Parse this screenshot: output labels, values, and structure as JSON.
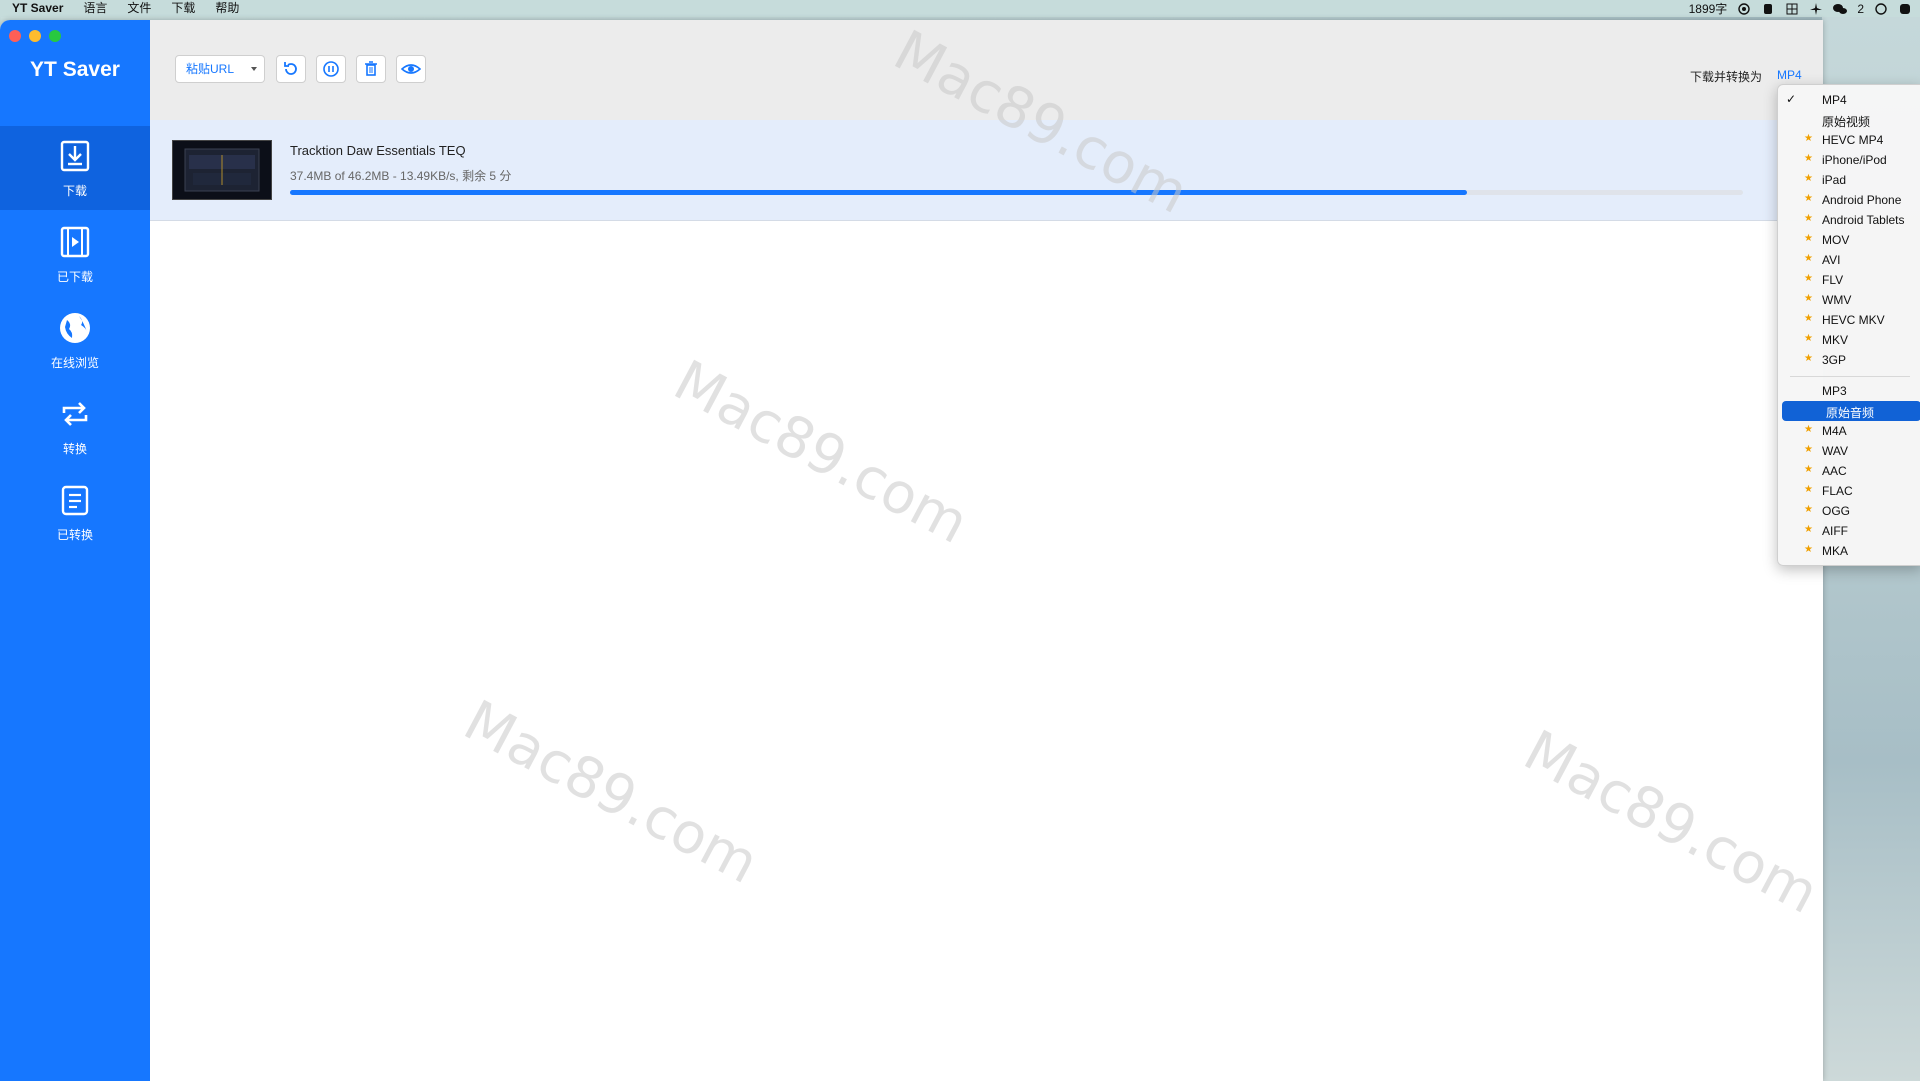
{
  "menubar": {
    "items": [
      "YT Saver",
      "语言",
      "文件",
      "下载",
      "帮助"
    ],
    "word_count": "1899字",
    "wechat_badge": "2"
  },
  "app": {
    "title": "YT Saver"
  },
  "sidebar": {
    "items": [
      {
        "label": "下载",
        "icon": "download-icon"
      },
      {
        "label": "已下载",
        "icon": "film-icon"
      },
      {
        "label": "在线浏览",
        "icon": "globe-icon"
      },
      {
        "label": "转换",
        "icon": "convert-icon"
      },
      {
        "label": "已转换",
        "icon": "document-list-icon"
      }
    ]
  },
  "toolbar": {
    "paste_url_label": "粘贴URL",
    "format_label": "下载并转换为",
    "format_value": "MP4"
  },
  "download": {
    "title": "Tracktion Daw Essentials TEQ",
    "status": "37.4MB of 46.2MB - 13.49KB/s, 剩余 5 分",
    "progress": 0.81
  },
  "format_menu": {
    "video": [
      {
        "label": "MP4",
        "checked": true,
        "star": false
      },
      {
        "label": "原始视频",
        "checked": false,
        "star": false
      },
      {
        "label": "HEVC MP4",
        "checked": false,
        "star": true
      },
      {
        "label": "iPhone/iPod",
        "checked": false,
        "star": true
      },
      {
        "label": "iPad",
        "checked": false,
        "star": true
      },
      {
        "label": "Android Phone",
        "checked": false,
        "star": true
      },
      {
        "label": "Android Tablets",
        "checked": false,
        "star": true
      },
      {
        "label": "MOV",
        "checked": false,
        "star": true
      },
      {
        "label": "AVI",
        "checked": false,
        "star": true
      },
      {
        "label": "FLV",
        "checked": false,
        "star": true
      },
      {
        "label": "WMV",
        "checked": false,
        "star": true
      },
      {
        "label": "HEVC MKV",
        "checked": false,
        "star": true
      },
      {
        "label": "MKV",
        "checked": false,
        "star": true
      },
      {
        "label": "3GP",
        "checked": false,
        "star": true
      }
    ],
    "audio": [
      {
        "label": "MP3",
        "checked": false,
        "star": false,
        "highlighted": false
      },
      {
        "label": "原始音频",
        "checked": false,
        "star": false,
        "highlighted": true
      },
      {
        "label": "M4A",
        "checked": false,
        "star": true,
        "highlighted": false
      },
      {
        "label": "WAV",
        "checked": false,
        "star": true,
        "highlighted": false
      },
      {
        "label": "AAC",
        "checked": false,
        "star": true,
        "highlighted": false
      },
      {
        "label": "FLAC",
        "checked": false,
        "star": true,
        "highlighted": false
      },
      {
        "label": "OGG",
        "checked": false,
        "star": true,
        "highlighted": false
      },
      {
        "label": "AIFF",
        "checked": false,
        "star": true,
        "highlighted": false
      },
      {
        "label": "MKA",
        "checked": false,
        "star": true,
        "highlighted": false
      }
    ]
  },
  "watermark": "Mac89.com",
  "colors": {
    "accent": "#1677ff",
    "sidebar_active": "#0f63df",
    "menu_highlight": "#1162d6",
    "star": "#f0a000"
  }
}
